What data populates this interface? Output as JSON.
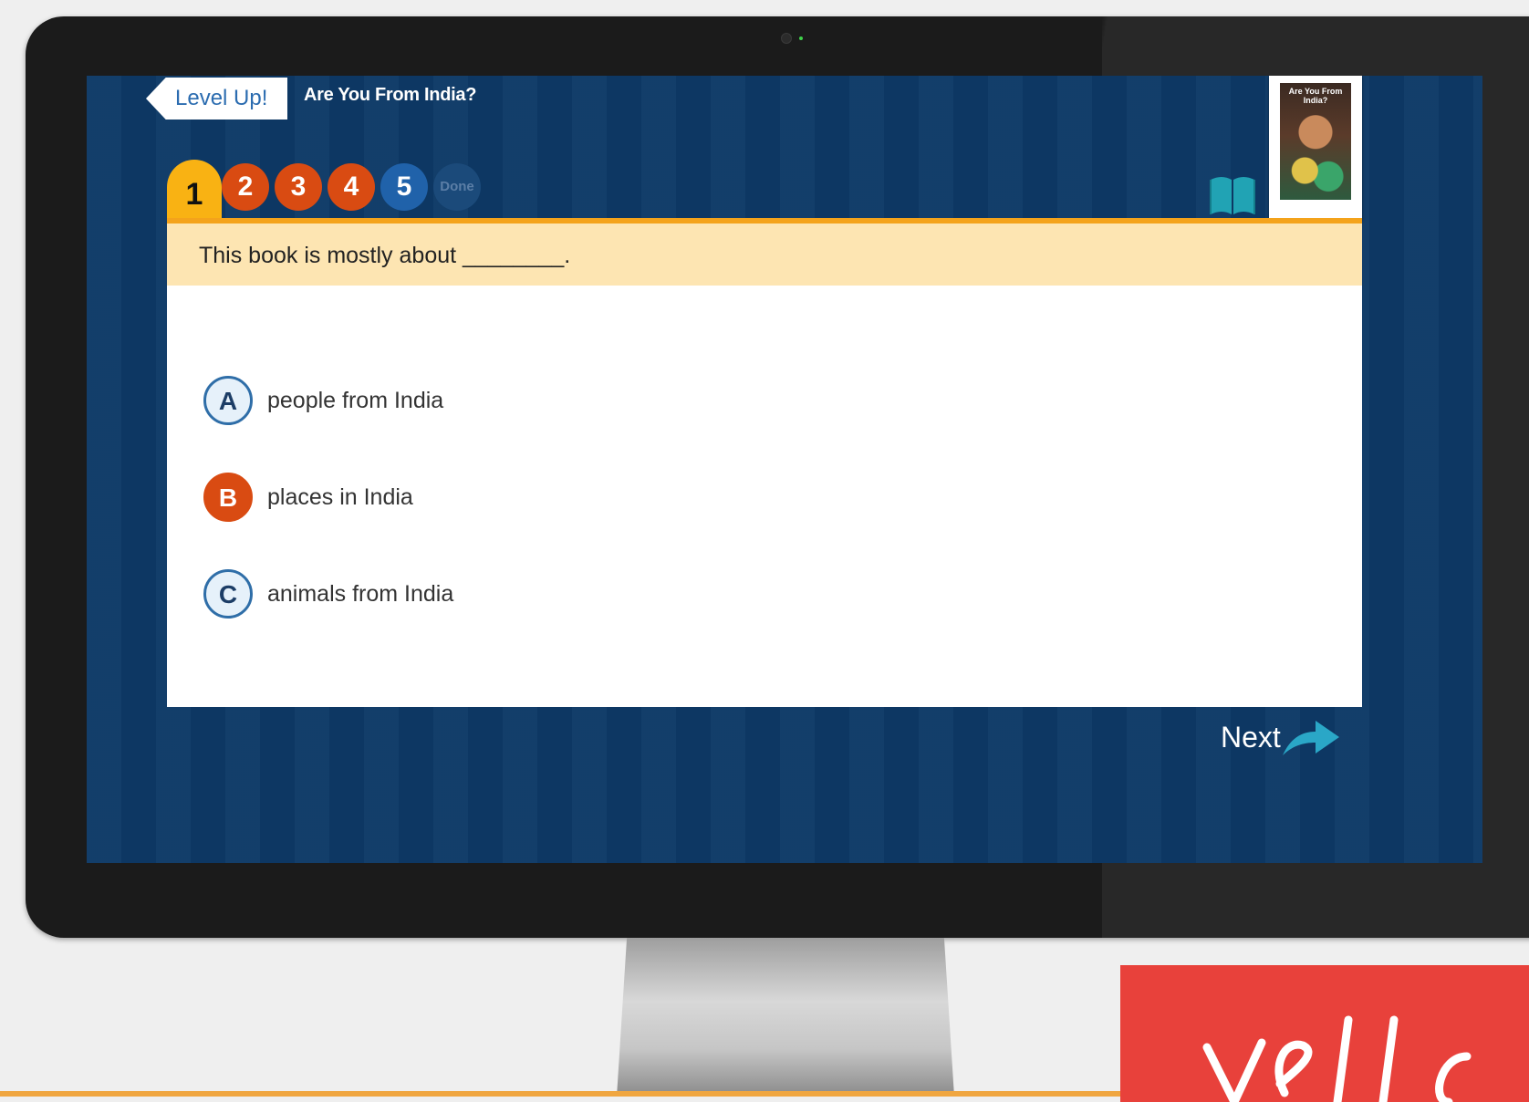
{
  "header": {
    "level_up_label": "Level Up!",
    "book_title": "Are You From India?"
  },
  "cover": {
    "title_text": "Are You From India?"
  },
  "tabs": [
    {
      "label": "1",
      "state": "active",
      "color": "#f9b213"
    },
    {
      "label": "2",
      "state": "answered",
      "color": "#d94b12"
    },
    {
      "label": "3",
      "state": "answered",
      "color": "#d94b12"
    },
    {
      "label": "4",
      "state": "answered",
      "color": "#d94b12"
    },
    {
      "label": "5",
      "state": "unanswered",
      "color": "#2062aa"
    },
    {
      "label": "Done",
      "state": "disabled",
      "color": "#1b4a7a"
    }
  ],
  "question": {
    "prompt": "This book is mostly about ________.",
    "options": [
      {
        "letter": "A",
        "text": "people from India",
        "selected": false
      },
      {
        "letter": "B",
        "text": "places in India",
        "selected": true
      },
      {
        "letter": "C",
        "text": "animals from India",
        "selected": false
      }
    ]
  },
  "navigation": {
    "next_label": "Next"
  },
  "colors": {
    "screen_background": "#0d3966",
    "accent_yellow": "#f9b213",
    "accent_orange": "#d94b12",
    "prompt_background": "#fde5b2",
    "brand_red": "#e8413b"
  },
  "icons": {
    "book": "open-book-icon",
    "next": "arrow-right-icon"
  }
}
